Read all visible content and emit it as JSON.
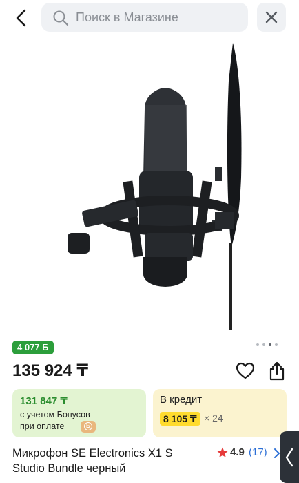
{
  "search": {
    "placeholder": "Поиск в Магазине"
  },
  "icons": {
    "back": "chevron-left-icon",
    "search": "search-icon",
    "close": "close-icon",
    "favorite": "heart-icon",
    "share": "share-icon",
    "rating": "star-icon",
    "rating_more": "chevron-right-icon",
    "side": "chevron-left-icon"
  },
  "gallery": {
    "image_count": 4,
    "active_index": 2
  },
  "bonus_badge": "4 077 Б",
  "price": "135 924 ₸",
  "bonus_card": {
    "amount": "131 847 ₸",
    "line1": "с учетом Бонусов",
    "line2": "при оплате"
  },
  "credit_card": {
    "title": "В кредит",
    "monthly": "8 105 ₸",
    "months": "× 24"
  },
  "product": {
    "title": "Микрофон SE Electronics X1 S Studio Bundle черный",
    "rating": "4.9",
    "reviews": "(17)"
  },
  "colors": {
    "accent_green": "#2c9e3b",
    "bonus_bg": "#e3f4d2",
    "credit_bg": "#fbf3cf",
    "credit_highlight": "#ffdb2e",
    "link_blue": "#2c6fd6",
    "star_red": "#e63a3a"
  }
}
